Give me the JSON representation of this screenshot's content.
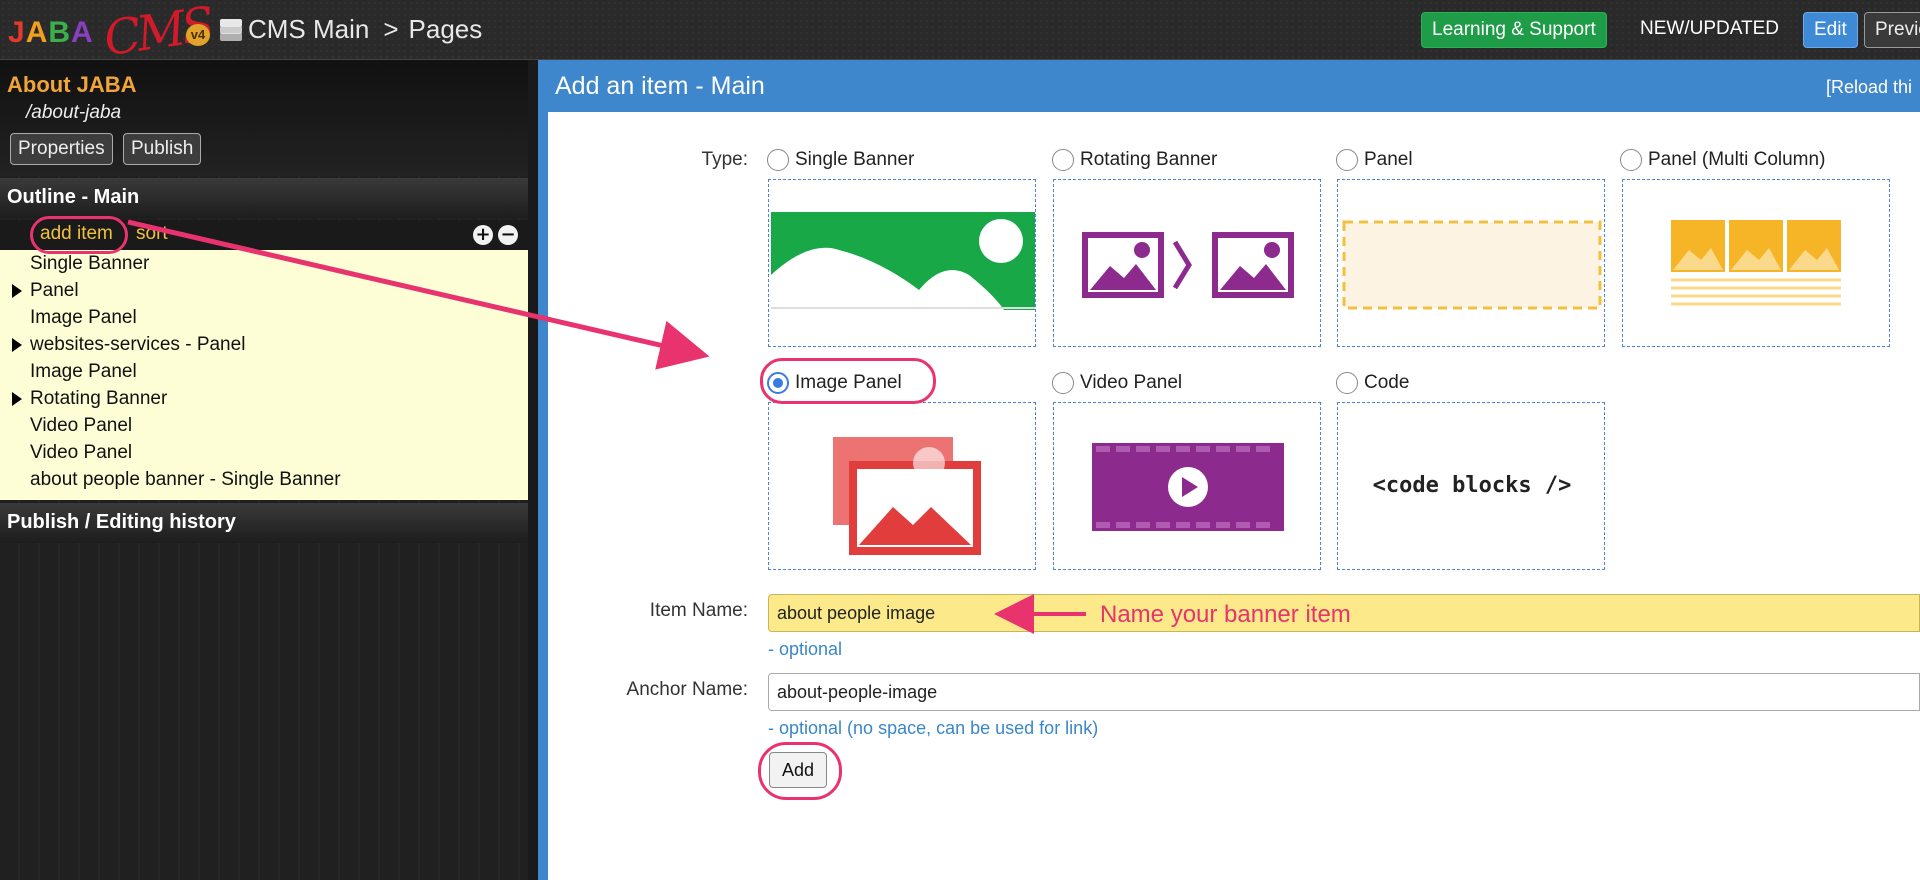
{
  "topbar": {
    "logo_text": "JABA",
    "logo_script": "CMS",
    "logo_version": "v4",
    "breadcrumb_root": "CMS Main",
    "breadcrumb_sep": ">",
    "breadcrumb_current": "Pages",
    "learning_label": "Learning & Support",
    "new_updated_label": "NEW/UPDATED",
    "edit_label": "Edit",
    "preview_label": "Previe"
  },
  "sidebar": {
    "page_title": "About JABA",
    "page_path": "/about-jaba",
    "properties_label": "Properties",
    "publish_label": "Publish",
    "outline_title": "Outline - Main",
    "add_item_label": "add item",
    "sort_label": "sort",
    "outline_items": [
      {
        "label": "Single Banner",
        "expandable": false
      },
      {
        "label": "Panel",
        "expandable": true
      },
      {
        "label": "Image Panel",
        "expandable": false
      },
      {
        "label": "websites-services - Panel",
        "expandable": true
      },
      {
        "label": "Image Panel",
        "expandable": false
      },
      {
        "label": "Rotating Banner",
        "expandable": true
      },
      {
        "label": "Video Panel",
        "expandable": false
      },
      {
        "label": "Video Panel",
        "expandable": false
      },
      {
        "label": "about people banner - Single Banner",
        "expandable": false
      }
    ],
    "history_title": "Publish / Editing history"
  },
  "main": {
    "title": "Add an item - Main",
    "reload_label": "[Reload thi",
    "type_label": "Type:",
    "types": [
      {
        "label": "Single Banner",
        "selected": false
      },
      {
        "label": "Rotating Banner",
        "selected": false
      },
      {
        "label": "Panel",
        "selected": false
      },
      {
        "label": "Panel (Multi Column)",
        "selected": false
      },
      {
        "label": "Image Panel",
        "selected": true
      },
      {
        "label": "Video Panel",
        "selected": false
      },
      {
        "label": "Code",
        "selected": false
      }
    ],
    "code_thumb_text": "<code blocks />",
    "item_name_label": "Item Name:",
    "item_name_value": "about people image",
    "item_name_hint": "- optional",
    "anchor_label": "Anchor Name:",
    "anchor_value": "about-people-image",
    "anchor_hint": "- optional (no space, can be used for link)",
    "add_label": "Add"
  },
  "annotation": {
    "callout": "Name your banner item"
  },
  "colors": {
    "accent_blue": "#3e87cc",
    "annotation_pink": "#e8336e",
    "outline_bg": "#fefed6",
    "learning_green": "#1f9c48"
  }
}
